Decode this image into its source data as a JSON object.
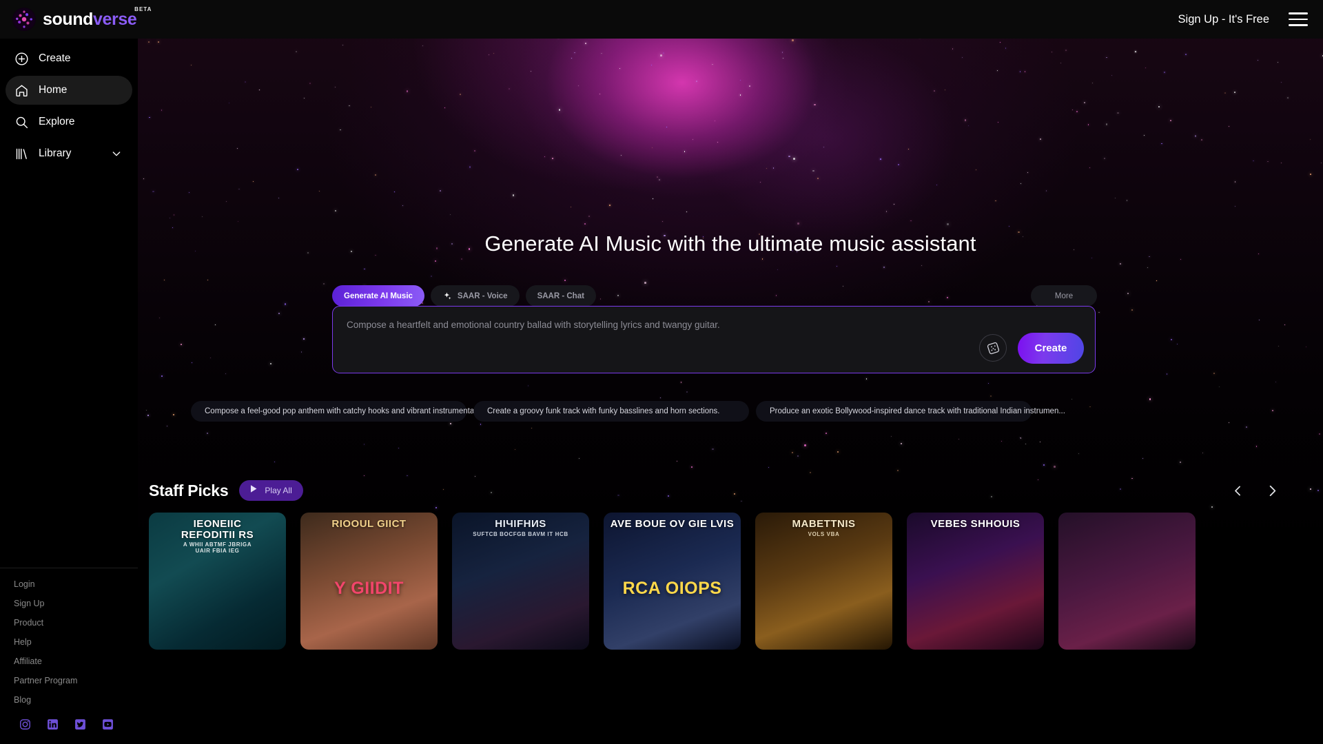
{
  "brand": {
    "word1": "sound",
    "word2": "verse",
    "beta": "BETA",
    "logo_icon": "soundverse-dot-circle-logo"
  },
  "header": {
    "signup_label": "Sign Up - It's Free",
    "menu_icon": "hamburger-menu-icon"
  },
  "sidebar": {
    "items": [
      {
        "label": "Create",
        "icon": "plus-circle-icon",
        "active": false
      },
      {
        "label": "Home",
        "icon": "home-icon",
        "active": true
      },
      {
        "label": "Explore",
        "icon": "search-icon",
        "active": false
      },
      {
        "label": "Library",
        "icon": "library-books-icon",
        "active": false,
        "chevron": "chevron-down-icon"
      }
    ],
    "footer_links": [
      "Login",
      "Sign Up",
      "Product",
      "Help",
      "Affiliate",
      "Partner Program",
      "Blog"
    ],
    "socials": [
      {
        "name": "instagram-icon"
      },
      {
        "name": "linkedin-icon"
      },
      {
        "name": "twitter-icon"
      },
      {
        "name": "youtube-icon"
      }
    ]
  },
  "hero": {
    "headline": "Generate AI Music with the ultimate music assistant",
    "tabs": [
      {
        "label": "Generate AI Music",
        "active": true,
        "icon": null
      },
      {
        "label": "SAAR - Voice",
        "active": false,
        "icon": "sparkle-icon"
      },
      {
        "label": "SAAR - Chat",
        "active": false,
        "icon": null
      }
    ],
    "more_label": "More",
    "prompt": {
      "placeholder": "Compose a heartfelt and emotional country ballad with storytelling lyrics and twangy guitar.",
      "value": "",
      "dice_icon": "dice-randomize-icon",
      "create_label": "Create"
    },
    "suggestions": [
      "Compose a feel-good pop anthem with catchy hooks and vibrant instrumentation. ...",
      "Create a groovy funk track with funky basslines and horn sections.",
      "Produce an exotic Bollywood-inspired dance track with traditional Indian instrumen..."
    ]
  },
  "staff_picks": {
    "title": "Staff Picks",
    "play_all_label": "Play All",
    "play_icon": "play-triangle-icon",
    "prev_icon": "chevron-left-icon",
    "next_icon": "chevron-right-icon",
    "cards": [
      {
        "art_title": "IEONEIIC\nREFODITII RS",
        "art_sub": "A WHII ABTMF JBRIGA\nUAIR FBIA IEG",
        "art_big": "",
        "title_color": "#ffffff",
        "bg": "linear-gradient(150deg,#0b3b42 0%,#124b52 35%,#062a33 70%,#021a20 100%)"
      },
      {
        "art_title": "RIOOUL GIICT",
        "art_sub": "",
        "art_big": "Y GIIDIT",
        "title_color": "#f0d08a",
        "big_color": "#f2456b",
        "bg": "linear-gradient(160deg,#3d2a1c 0%,#7a4a32 40%,#a8654a 70%,#5c3524 100%)"
      },
      {
        "art_title": "HIЧIFHИS",
        "art_sub": "SUFTCB BOCFGB BAVM IT HCB",
        "art_big": "",
        "title_color": "#e8eef7",
        "bg": "linear-gradient(160deg,#0a1428 0%,#16233f 40%,#2a1830 75%,#0b0a18 100%)"
      },
      {
        "art_title": "AVE BOUE OV GIE LVIS",
        "art_sub": "",
        "art_big": "RCA OIOPS",
        "title_color": "#ffffff",
        "big_color": "#ffd84a",
        "bg": "linear-gradient(160deg,#0d1530 0%,#1b2a52 45%,#324068 75%,#0a0f22 100%)"
      },
      {
        "art_title": "MABETTNIS",
        "art_sub": "VOLS VBA",
        "art_big": "",
        "title_color": "#f5e8c8",
        "bg": "linear-gradient(160deg,#2a1a08 0%,#5a3a12 40%,#8a5e1e 68%,#241603 100%)"
      },
      {
        "art_title": "VEBES SHHOUIS",
        "art_sub": "",
        "art_big": "",
        "title_color": "#ffffff",
        "bg": "linear-gradient(160deg,#1a0a2a 0%,#3a1050 38%,#6a1838 70%,#1c0618 100%)"
      },
      {
        "art_title": "",
        "art_sub": "",
        "art_big": "",
        "title_color": "#ffffff",
        "bg": "linear-gradient(160deg,#241028 0%,#4a1840 45%,#6a2048 75%,#1a0a18 100%)"
      }
    ]
  },
  "colors": {
    "accent_purple": "#7c3aed",
    "accent_violet": "#8b5cf6",
    "play_all_bg": "#4c1d95",
    "sidebar_bg": "#000000",
    "active_nav_bg": "#1b1b1b"
  }
}
